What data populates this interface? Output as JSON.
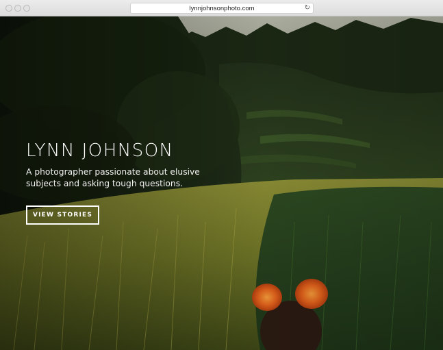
{
  "browser": {
    "url": "lynnjohnsonphoto.com",
    "reload_icon": "reload-icon"
  },
  "hero": {
    "title": "LYNN JOHNSON",
    "tagline": "A photographer passionate about elusive subjects and asking tough questions.",
    "cta_label": "VIEW STORIES"
  },
  "colors": {
    "sky": "#a8ab9b",
    "forest_dark": "#1c2a15",
    "field_gold": "#8a8a33",
    "flower_orange": "#e0661d",
    "text_white": "#ffffff"
  }
}
